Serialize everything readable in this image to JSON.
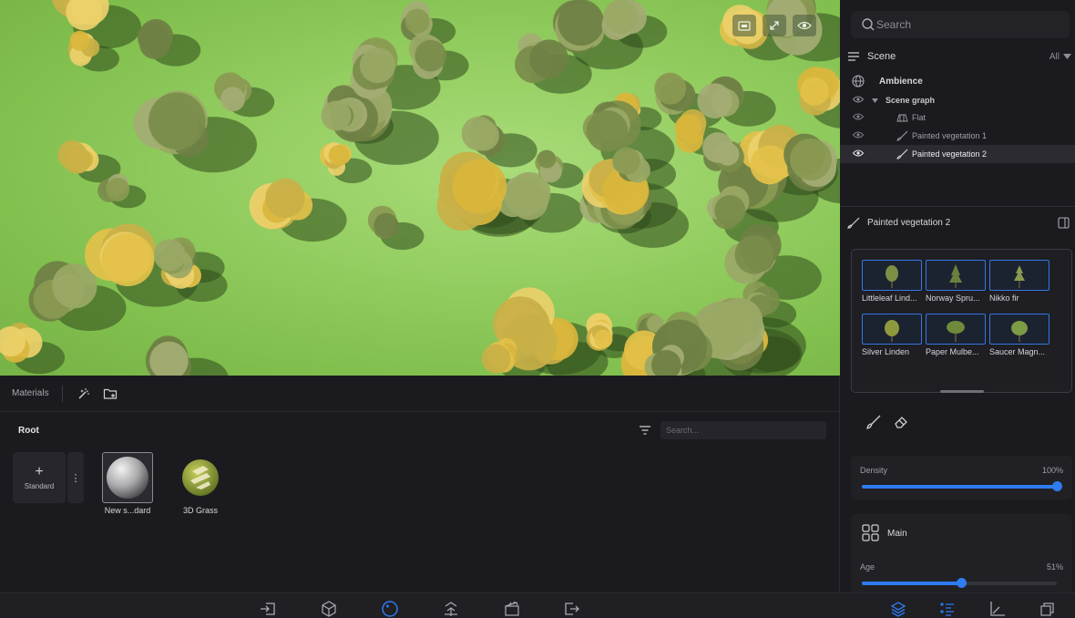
{
  "viewport": {
    "tools": [
      {
        "icon": "camera-view-icon"
      },
      {
        "icon": "expand-icon"
      },
      {
        "icon": "eye-icon"
      }
    ]
  },
  "materials": {
    "title": "Materials",
    "root_label": "Root",
    "search_placeholder": "Search...",
    "standard_label": "Standard",
    "items": [
      {
        "name": "New s...dard",
        "selected": true
      },
      {
        "name": "3D Grass",
        "selected": false
      }
    ]
  },
  "right": {
    "search_placeholder": "Search",
    "scene_title": "Scene",
    "scene_filter": "All",
    "tree": {
      "ambience": "Ambience",
      "scene_graph": "Scene graph",
      "flat": "Flat",
      "veg1": "Painted vegetation 1",
      "veg2": "Painted vegetation 2"
    },
    "selected_title": "Painted vegetation 2",
    "vegetation": [
      {
        "name": "Littleleaf Lind..."
      },
      {
        "name": "Norway Spru..."
      },
      {
        "name": "Nikko fir"
      },
      {
        "name": "Silver Linden"
      },
      {
        "name": "Paper Mulbe..."
      },
      {
        "name": "Saucer Magn..."
      }
    ],
    "density": {
      "label": "Density",
      "value_text": "100%",
      "value": 1.0
    },
    "main_title": "Main",
    "age": {
      "label": "Age",
      "value_text": "51%",
      "value": 0.51
    }
  },
  "colors": {
    "accent": "#2f7bf0",
    "panel": "#1b1b1f"
  }
}
